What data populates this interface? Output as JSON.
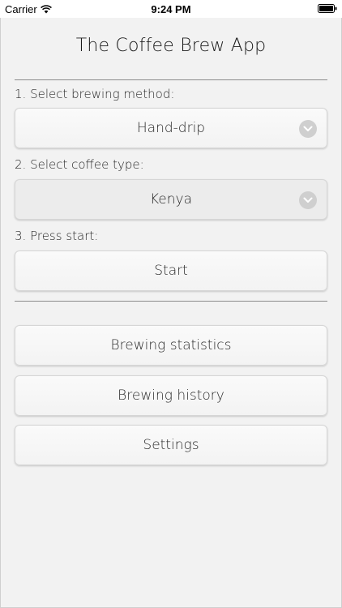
{
  "status_bar": {
    "carrier": "Carrier",
    "time": "9:24 PM"
  },
  "header": {
    "title": "The Coffee Brew App"
  },
  "steps": {
    "method_label": "1. Select brewing method:",
    "method_value": "Hand-drip",
    "coffee_label": "2. Select coffee type:",
    "coffee_value": "Kenya",
    "start_label": "3. Press start:",
    "start_button": "Start"
  },
  "menu": {
    "statistics": "Brewing statistics",
    "history": "Brewing history",
    "settings": "Settings"
  },
  "icons": {
    "dropdown": "chevron-down-icon",
    "wifi": "wifi-icon",
    "battery": "battery-icon"
  }
}
